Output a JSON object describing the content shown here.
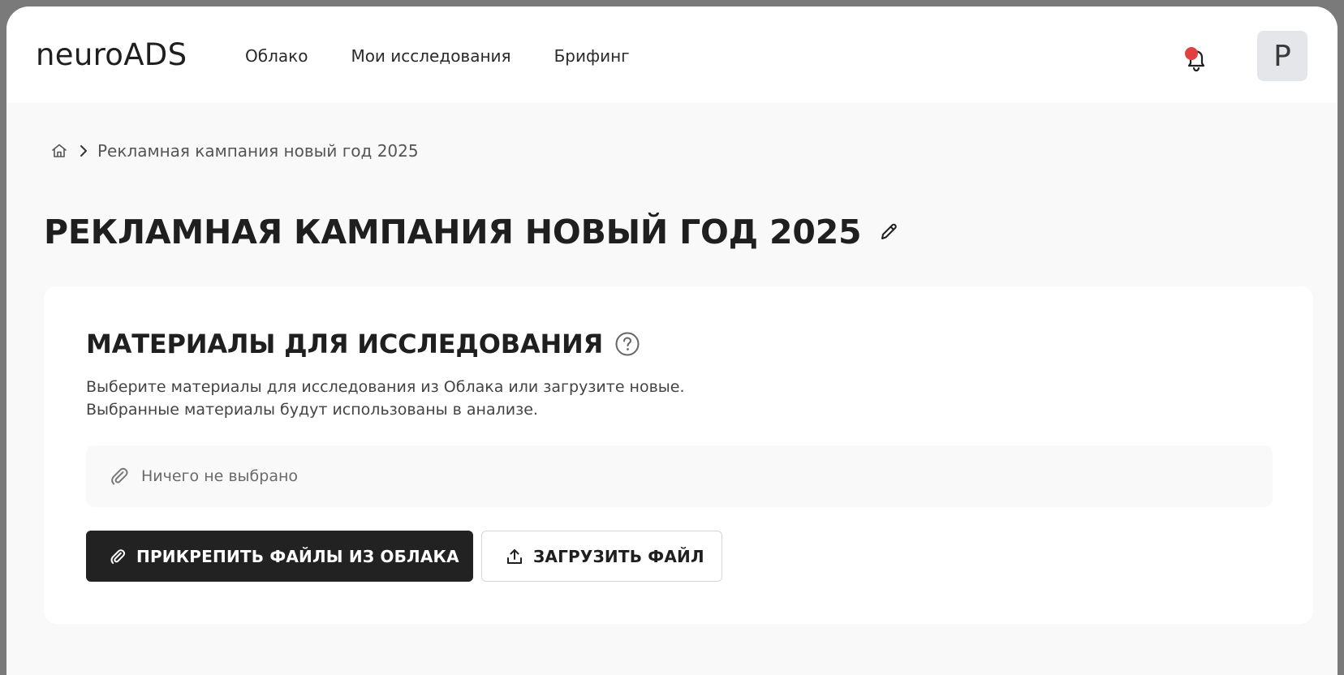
{
  "header": {
    "logo": "neuroADS",
    "nav": [
      {
        "label": "Облако"
      },
      {
        "label": "Мои исследования"
      },
      {
        "label": "Брифинг"
      }
    ],
    "notifications": {
      "icon": "bell-icon",
      "has_unread": true,
      "dot_color": "#e0403e"
    },
    "avatar_initial": "P"
  },
  "breadcrumb": {
    "home_icon": "home-icon",
    "separator_icon": "chevron-right-icon",
    "current": "Рекламная кампания новый год 2025"
  },
  "page": {
    "title": "РЕКЛАМНАЯ КАМПАНИЯ НОВЫЙ ГОД 2025",
    "edit_icon": "pencil-icon"
  },
  "materials": {
    "title": "МАТЕРИАЛЫ ДЛЯ ИССЛЕДОВАНИЯ",
    "help_icon": "help-circle-icon",
    "description_line1": "Выберите материалы для исследования из Облака или загрузите новые.",
    "description_line2": "Выбранные материалы будут использованы в анализе.",
    "files_placeholder": "Ничего не выбрано",
    "attach_button": "ПРИКРЕПИТЬ ФАЙЛЫ ИЗ ОБЛАКА",
    "upload_button": "ЗАГРУЗИТЬ ФАЙЛ"
  },
  "colors": {
    "primary_button_bg": "#222222",
    "page_bg": "#f9f9f9",
    "card_bg": "#ffffff",
    "notification_dot": "#e0403e"
  }
}
